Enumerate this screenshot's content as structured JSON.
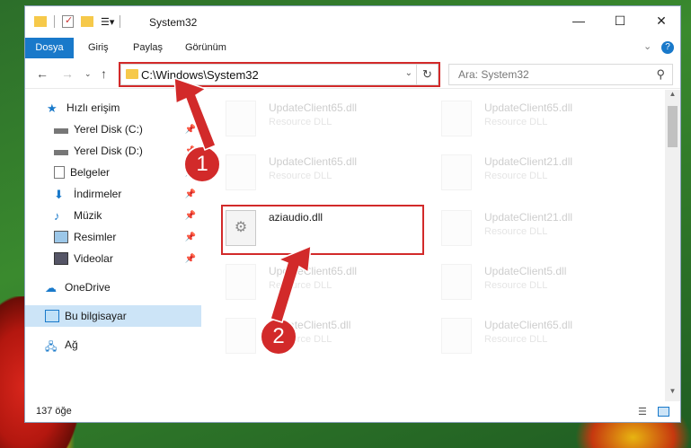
{
  "window": {
    "title": "System32",
    "close_glyph": "✕",
    "maximize_glyph": "☐",
    "minimize_glyph": "—"
  },
  "ribbon": {
    "tabs": [
      "Dosya",
      "Giriş",
      "Paylaş",
      "Görünüm"
    ]
  },
  "address": {
    "path": "C:\\Windows\\System32",
    "search_placeholder": "Ara: System32"
  },
  "sidebar": {
    "items": [
      {
        "label": "Hızlı erişim"
      },
      {
        "label": "Yerel Disk (C:)"
      },
      {
        "label": "Yerel Disk (D:)"
      },
      {
        "label": "Belgeler"
      },
      {
        "label": "İndirmeler"
      },
      {
        "label": "Müzik"
      },
      {
        "label": "Resimler"
      },
      {
        "label": "Videolar"
      },
      {
        "label": "OneDrive"
      },
      {
        "label": "Bu bilgisayar"
      },
      {
        "label": "Ağ"
      }
    ]
  },
  "files": [
    {
      "name": "UpdateClient65.dll",
      "type": "Resource DLL"
    },
    {
      "name": "UpdateClient65.dll",
      "type": "Resource DLL"
    },
    {
      "name": "UpdateClient65.dll",
      "type": "Resource DLL"
    },
    {
      "name": "UpdateClient21.dll",
      "type": "Resource DLL"
    },
    {
      "name": "aziaudio.dll",
      "type": ""
    },
    {
      "name": "UpdateClient21.dll",
      "type": "Resource DLL"
    },
    {
      "name": "UpdateClient65.dll",
      "type": "Resource DLL"
    },
    {
      "name": "UpdateClient5.dll",
      "type": "Resource DLL"
    },
    {
      "name": "UpdateClient5.dll",
      "type": "Resource DLL"
    },
    {
      "name": "UpdateClient65.dll",
      "type": "Resource DLL"
    }
  ],
  "status": {
    "count_text": "137 öğe"
  },
  "annotations": {
    "badge1": "1",
    "badge2": "2"
  },
  "colors": {
    "accent": "#1979ca",
    "highlight": "#d22a2a",
    "selected": "#cce4f7"
  }
}
